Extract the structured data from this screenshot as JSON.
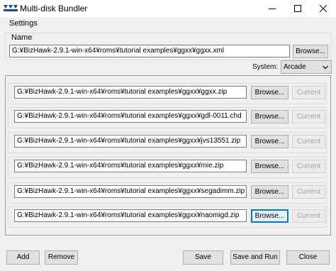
{
  "window": {
    "title": "Multi-disk Bundler"
  },
  "menu": {
    "settings_label": "Settings"
  },
  "name_section": {
    "label": "Name",
    "path": "G:¥BizHawk-2.9.1-win-x64¥roms¥tutorial examples¥ggxx¥ggxx.xml",
    "browse_label": "Browse..."
  },
  "system": {
    "label": "System:",
    "selected": "Arcade"
  },
  "entries": [
    {
      "path": "G:¥BizHawk-2.9.1-win-x64¥roms¥tutorial examples¥ggxx¥ggxx.zip",
      "browse_label": "Browse...",
      "current_label": "Current"
    },
    {
      "path": "G:¥BizHawk-2.9.1-win-x64¥roms¥tutorial examples¥ggxx¥gdl-0011.chd",
      "browse_label": "Browse...",
      "current_label": "Current"
    },
    {
      "path": "G:¥BizHawk-2.9.1-win-x64¥roms¥tutorial examples¥ggxx¥jvs13551.zip",
      "browse_label": "Browse...",
      "current_label": "Current"
    },
    {
      "path": "G:¥BizHawk-2.9.1-win-x64¥roms¥tutorial examples¥ggxx¥mie.zip",
      "browse_label": "Browse...",
      "current_label": "Current"
    },
    {
      "path": "G:¥BizHawk-2.9.1-win-x64¥roms¥tutorial examples¥ggxx¥segadimm.zip",
      "browse_label": "Browse...",
      "current_label": "Current"
    },
    {
      "path": "G:¥BizHawk-2.9.1-win-x64¥roms¥tutorial examples¥ggxx¥naomigd.zip",
      "browse_label": "Browse...",
      "current_label": "Current"
    }
  ],
  "buttons": {
    "add": "Add",
    "remove": "Remove",
    "save": "Save",
    "save_and_run": "Save and Run",
    "close": "Close"
  },
  "icons": {
    "app": "app-icon",
    "minimize": "minimize-icon",
    "maximize": "maximize-icon",
    "close": "close-icon",
    "dropdown": "chevron-down-icon"
  }
}
